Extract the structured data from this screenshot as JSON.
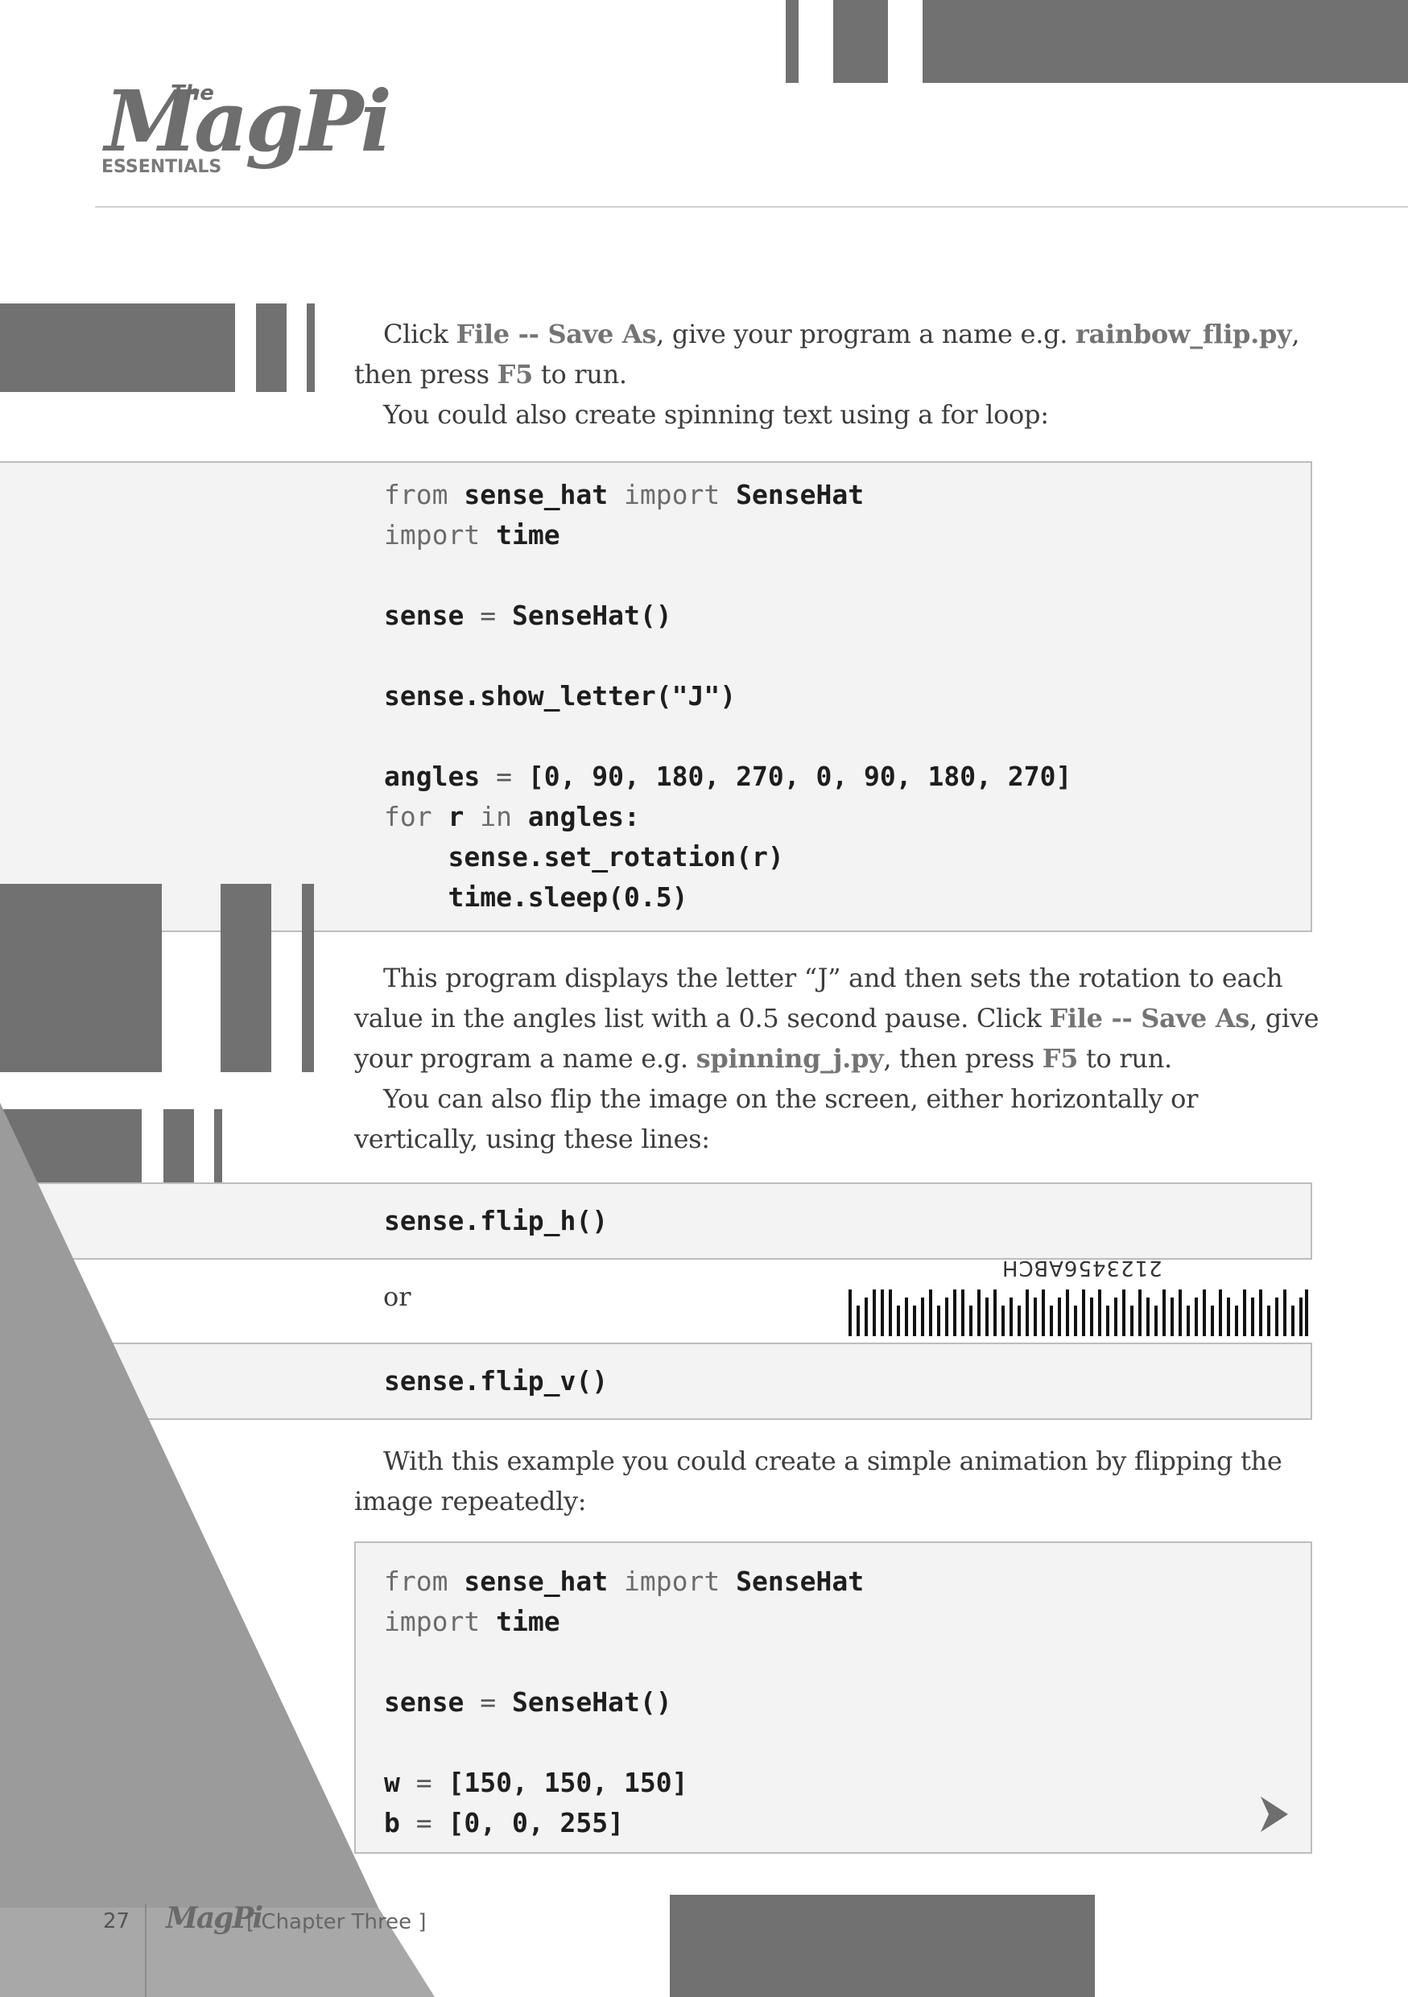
{
  "logo": {
    "the": "The",
    "name": "MagPi",
    "sub": "ESSENTIALS"
  },
  "paragraphs": {
    "p1": {
      "t1": "Click ",
      "h1": "File -- Save As",
      "t2": ", give your program a name e.g. ",
      "h2": "rainbow_flip.py",
      "t3": ", then press ",
      "h3": "F5",
      "t4": " to run."
    },
    "p2": "You could also create spinning text using a for loop:",
    "p3": {
      "t1": "This program displays the letter “J” and then sets the rotation to each value in the angles list with a 0.5 second pause. Click ",
      "h1": "File -- Save As",
      "t2": ", give your program a name e.g. ",
      "h2": "spinning_j.py",
      "t3": ", then press ",
      "h3": "F5",
      "t4": " to run."
    },
    "p4": "You can also flip the image on the screen, either horizontally or vertically, using these lines:",
    "p5": "With this example you could create a simple animation by flipping the image repeatedly:"
  },
  "code1": {
    "l1": {
      "a": "from",
      "b": " sense_hat ",
      "c": "import",
      "d": " SenseHat"
    },
    "l2": {
      "a": "import",
      "b": " time"
    },
    "l3": {
      "a": "sense",
      "b": " = ",
      "c": "SenseHat()"
    },
    "l4": "sense.show_letter(\"J\")",
    "l5": {
      "a": "angles",
      "b": " = ",
      "c": "[0, 90, 180, 270, 0, 90, 180, 270]"
    },
    "l6": {
      "a": "for",
      "b": " r ",
      "c": "in",
      "d": " angles:"
    },
    "l7": "    sense.set_rotation(r)",
    "l8": "    time.sleep(0.5)"
  },
  "code2": "sense.flip_h()",
  "or_label": "or",
  "code3": "sense.flip_v()",
  "code4": {
    "l1": {
      "a": "from",
      "b": " sense_hat ",
      "c": "import",
      "d": " SenseHat"
    },
    "l2": {
      "a": "import",
      "b": " time"
    },
    "l3": {
      "a": "sense",
      "b": " = ",
      "c": "SenseHat()"
    },
    "l4": {
      "a": "w",
      "b": " = ",
      "c": "[150, 150, 150]"
    },
    "l5": {
      "a": "b",
      "b": " = ",
      "c": "[0, 0, 255]"
    }
  },
  "barcode_text": "2123456ABCH",
  "footer": {
    "page": "27",
    "logo": "MagPi",
    "chapter": "[ Chapter Three ]"
  },
  "icons": {
    "next": "next-page-arrow-icon",
    "barcode": "barcode-icon"
  },
  "colors": {
    "block": "#717171",
    "code_bg": "#f3f3f3",
    "highlight": "#747474"
  }
}
